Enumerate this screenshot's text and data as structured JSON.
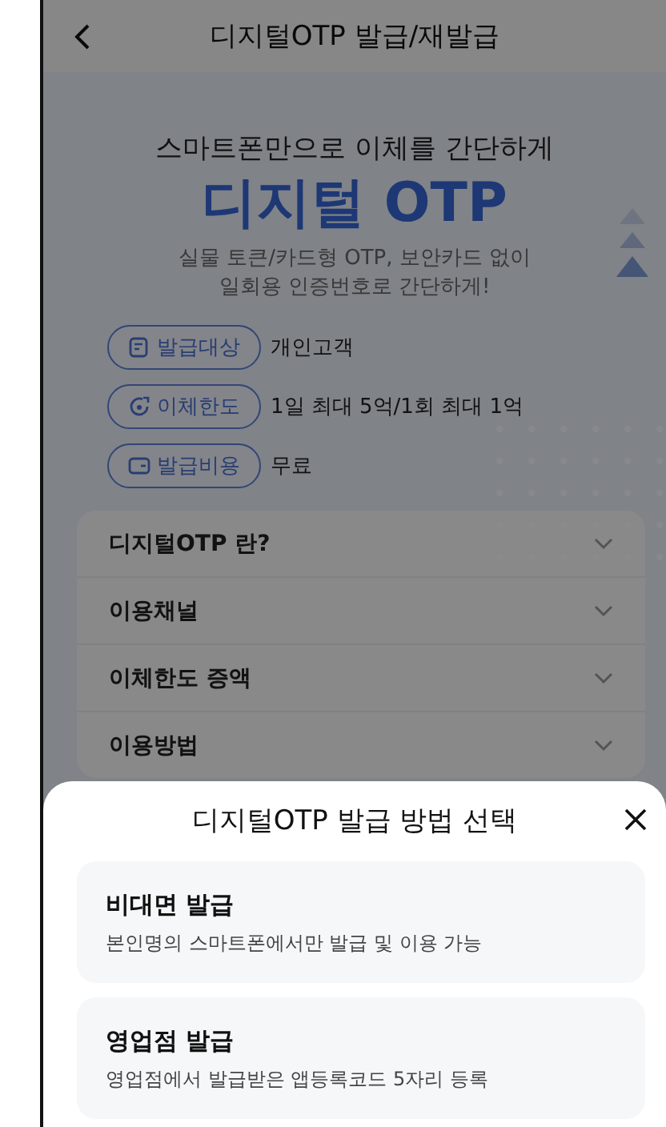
{
  "header": {
    "title": "디지털OTP 발급/재발급"
  },
  "hero": {
    "subtitle": "스마트폰만으로 이체를 간단하게",
    "title": "디지털 OTP",
    "description": [
      "실물 토큰/카드형 OTP, 보안카드 없이",
      "일회용 인증번호로 간단하게!"
    ]
  },
  "info": [
    {
      "kind": "target",
      "label": "발급대상",
      "value": "개인고객"
    },
    {
      "kind": "limit",
      "label": "이체한도",
      "value": "1일 최대 5억/1회 최대 1억"
    },
    {
      "kind": "cost",
      "label": "발급비용",
      "value": "무료"
    }
  ],
  "accordion": [
    {
      "label": "디지털OTP 란?",
      "expanded": false
    },
    {
      "label": "이용채널",
      "expanded": false
    },
    {
      "label": "이체한도 증액",
      "expanded": false
    },
    {
      "label": "이용방법",
      "expanded": false
    }
  ],
  "sheet": {
    "title": "디지털OTP 발급 방법 선택",
    "options": [
      {
        "title": "비대면 발급",
        "description": "본인명의 스마트폰에서만 발급 및 이용 가능"
      },
      {
        "title": "영업점 발급",
        "description": "영업점에서 발급받은 앱등록코드 5자리 등록"
      }
    ]
  }
}
